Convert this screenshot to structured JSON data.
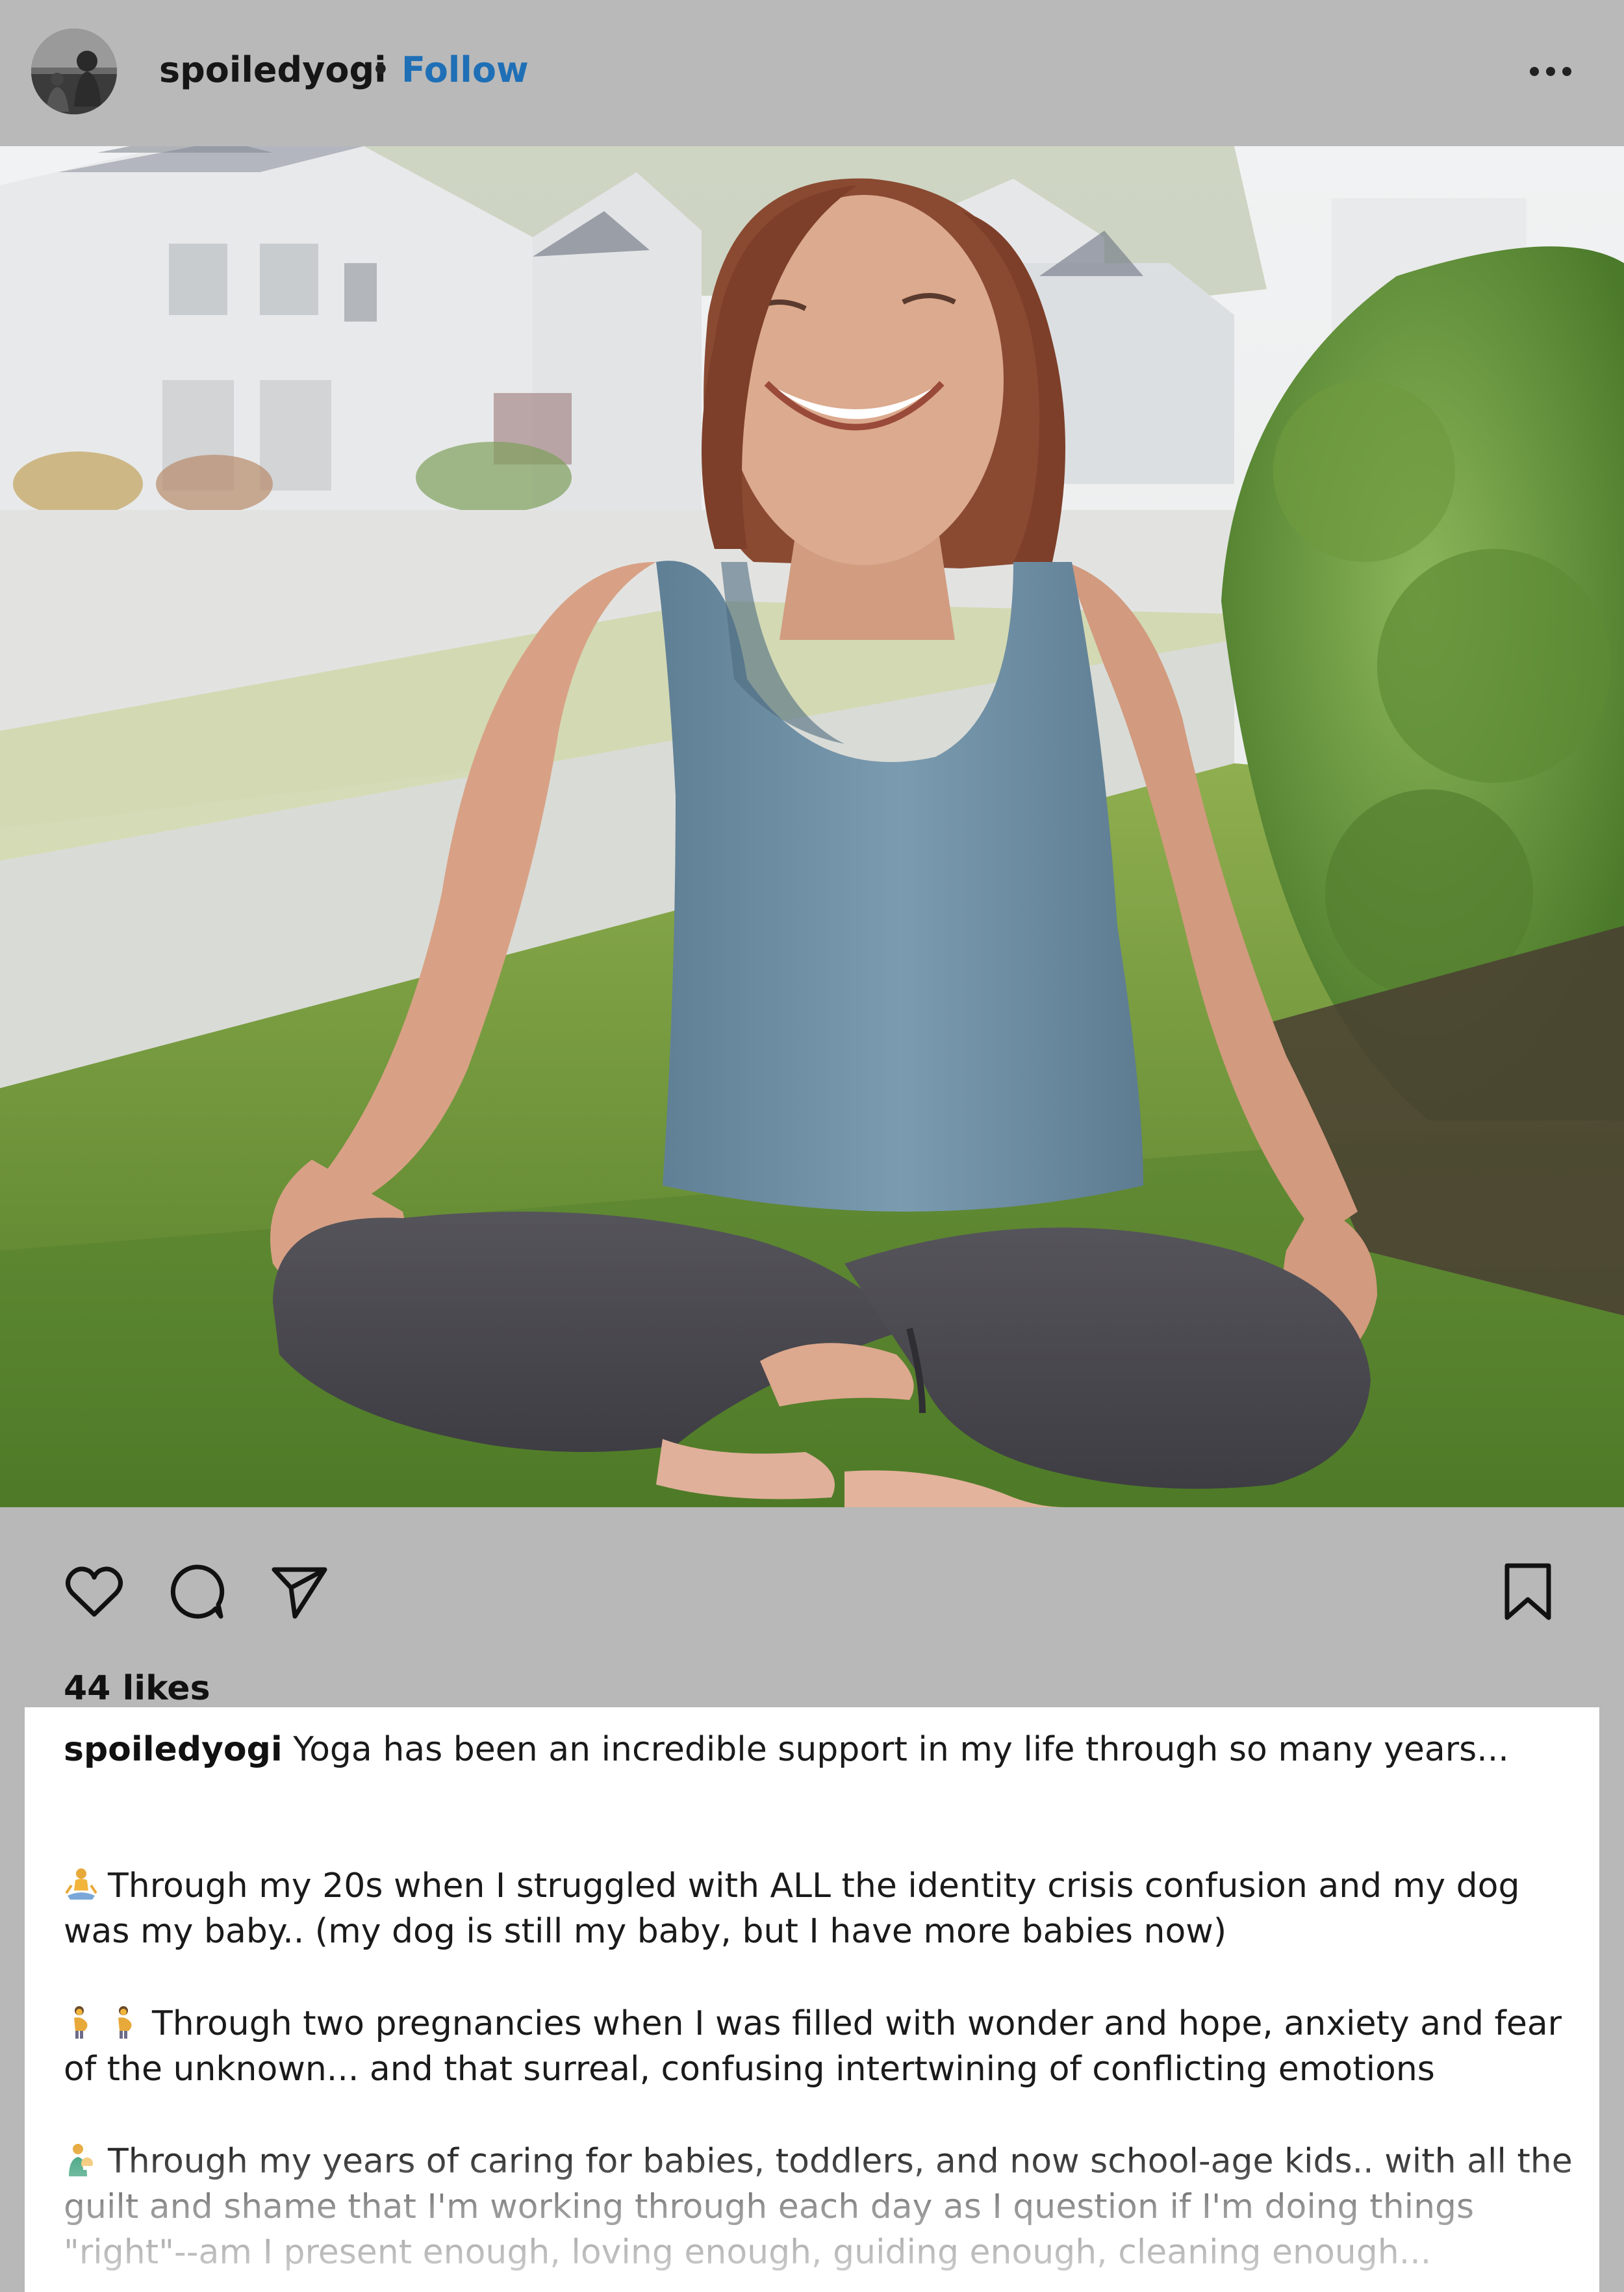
{
  "post": {
    "username": "spoiledyogi",
    "separator": "•",
    "follow_label": "Follow",
    "more_icon": "more-horizontal-icon"
  },
  "photo": {
    "alt": "Woman laughing while sitting cross-legged on grass in front of houses",
    "palette": {
      "sky": "#eef0f2",
      "houses": "#e9eaea",
      "grass": "#6b8f3a",
      "tank_top": "#6f8ea3",
      "leggings": "#4d4c52",
      "skin": "#d9a48a",
      "hair": "#8a4a32",
      "bush": "#5f8a37"
    }
  },
  "actions": {
    "like_icon": "heart-icon",
    "comment_icon": "comment-icon",
    "share_icon": "send-icon",
    "save_icon": "bookmark-icon"
  },
  "likes_label": "44 likes",
  "caption": {
    "author": "spoiledyogi",
    "intro": " Yoga has been an incredible support in my life through so many years...",
    "p1_emoji": "person-in-lotus-position-emoji",
    "p1": "Through my 20s when I struggled with ALL the identity crisis confusion and my dog was my baby.. (my dog is still my baby, but I have more babies now)",
    "p2_emoji": "pregnant-woman-emoji",
    "p2": "Through two pregnancies when I was filled with wonder and hope, anxiety and fear of the unknown... and that surreal, confusing intertwining of conflicting emotions",
    "p3_emoji": "woman-feeding-baby-emoji",
    "p3": "Through my years of caring for babies, toddlers, and now school-age kids.. with all the guilt and shame that I'm working through each day as I question if I'm doing things \"right\"--am I present enough, loving enough, guiding enough, cleaning enough..."
  },
  "colors": {
    "background": "#b8b8b8",
    "follow_blue": "#1f6fb6",
    "card": "#ffffff",
    "text": "#1a1a1a"
  }
}
